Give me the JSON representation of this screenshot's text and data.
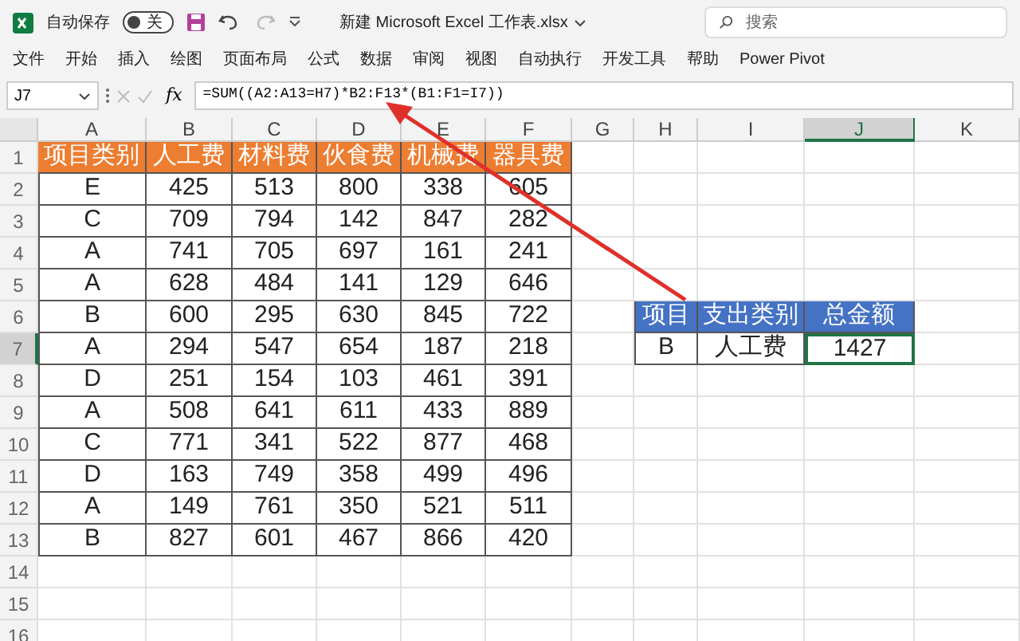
{
  "title_bar": {
    "autosave_label": "自动保存",
    "autosave_toggle": {
      "label": "关",
      "on": false
    },
    "file_name": "新建 Microsoft Excel 工作表.xlsx",
    "search": {
      "placeholder": "搜索"
    }
  },
  "ribbon_tabs": [
    {
      "label": "文件",
      "selected": false
    },
    {
      "label": "开始",
      "selected": false
    },
    {
      "label": "插入",
      "selected": false
    },
    {
      "label": "绘图",
      "selected": false
    },
    {
      "label": "页面布局",
      "selected": false
    },
    {
      "label": "公式",
      "selected": false
    },
    {
      "label": "数据",
      "selected": false
    },
    {
      "label": "审阅",
      "selected": false
    },
    {
      "label": "视图",
      "selected": false
    },
    {
      "label": "自动执行",
      "selected": false
    },
    {
      "label": "开发工具",
      "selected": false
    },
    {
      "label": "帮助",
      "selected": false
    },
    {
      "label": "Power Pivot",
      "selected": false
    }
  ],
  "formula_bar": {
    "name_box": "J7",
    "function_label": "fx",
    "formula": "=SUM((A2:A13=H7)*B2:F13*(B1:F1=I7))"
  },
  "columns": [
    {
      "label": "A",
      "selected": false
    },
    {
      "label": "B",
      "selected": false
    },
    {
      "label": "C",
      "selected": false
    },
    {
      "label": "D",
      "selected": false
    },
    {
      "label": "E",
      "selected": false
    },
    {
      "label": "F",
      "selected": false
    },
    {
      "label": "G",
      "selected": false
    },
    {
      "label": "H",
      "selected": false
    },
    {
      "label": "I",
      "selected": false
    },
    {
      "label": "J",
      "selected": true
    },
    {
      "label": "K",
      "selected": false
    }
  ],
  "row_numbers": [
    {
      "label": "1",
      "selected": false
    },
    {
      "label": "2",
      "selected": false
    },
    {
      "label": "3",
      "selected": false
    },
    {
      "label": "4",
      "selected": false
    },
    {
      "label": "5",
      "selected": false
    },
    {
      "label": "6",
      "selected": false
    },
    {
      "label": "7",
      "selected": true
    },
    {
      "label": "8",
      "selected": false
    },
    {
      "label": "9",
      "selected": false
    },
    {
      "label": "10",
      "selected": false
    },
    {
      "label": "11",
      "selected": false
    },
    {
      "label": "12",
      "selected": false
    },
    {
      "label": "13",
      "selected": false
    },
    {
      "label": "14",
      "selected": false
    },
    {
      "label": "15",
      "selected": false
    },
    {
      "label": "16",
      "selected": false
    }
  ],
  "data_table": {
    "header": [
      "项目类别",
      "人工费",
      "材料费",
      "伙食费",
      "机械费",
      "器具费"
    ],
    "rows": [
      [
        "E",
        "425",
        "513",
        "800",
        "338",
        "605"
      ],
      [
        "C",
        "709",
        "794",
        "142",
        "847",
        "282"
      ],
      [
        "A",
        "741",
        "705",
        "697",
        "161",
        "241"
      ],
      [
        "A",
        "628",
        "484",
        "141",
        "129",
        "646"
      ],
      [
        "B",
        "600",
        "295",
        "630",
        "845",
        "722"
      ],
      [
        "A",
        "294",
        "547",
        "654",
        "187",
        "218"
      ],
      [
        "D",
        "251",
        "154",
        "103",
        "461",
        "391"
      ],
      [
        "A",
        "508",
        "641",
        "611",
        "433",
        "889"
      ],
      [
        "C",
        "771",
        "341",
        "522",
        "877",
        "468"
      ],
      [
        "D",
        "163",
        "749",
        "358",
        "499",
        "496"
      ],
      [
        "A",
        "149",
        "761",
        "350",
        "521",
        "511"
      ],
      [
        "B",
        "827",
        "601",
        "467",
        "866",
        "420"
      ]
    ]
  },
  "summary_table": {
    "header": [
      "项目",
      "支出类别",
      "总金额"
    ],
    "row": [
      {
        "text": "B",
        "selected": false
      },
      {
        "text": "人工费",
        "selected": false
      },
      {
        "text": "1427",
        "selected": true
      }
    ]
  }
}
